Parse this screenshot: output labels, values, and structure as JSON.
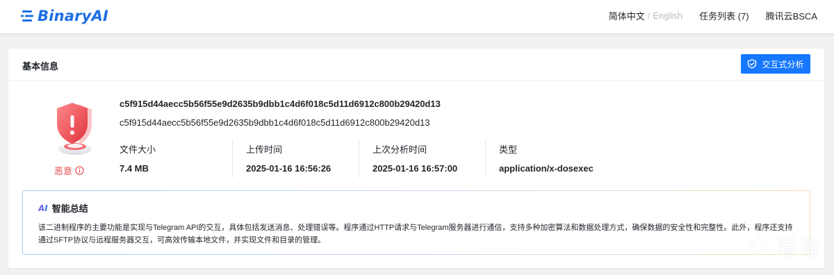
{
  "brand": {
    "name": "BinaryAI",
    "color": "#1b6fe4"
  },
  "nav": {
    "lang_current": "简体中文",
    "lang_separator": "/",
    "lang_other": "English",
    "tasks": "任务列表 (7)",
    "user": "腾讯云BSCA"
  },
  "card": {
    "title": "基本信息",
    "analyze_button": "交互式分析"
  },
  "file": {
    "verdict": "恶意",
    "verdict_color": "#e5484d",
    "hash_primary": "c5f915d44aecc5b56f55e9d2635b9dbb1c4d6f018c5d11d6912c800b29420d13",
    "hash_secondary": "c5f915d44aecc5b56f55e9d2635b9dbb1c4d6f018c5d11d6912c800b29420d13",
    "meta": [
      {
        "label": "文件大小",
        "value": "7.4 MB"
      },
      {
        "label": "上传时间",
        "value": "2025-01-16 16:56:26"
      },
      {
        "label": "上次分析时间",
        "value": "2025-01-16 16:57:00"
      },
      {
        "label": "类型",
        "value": "application/x-dosexec"
      }
    ]
  },
  "ai_summary": {
    "badge": "AI",
    "title": "智能总结",
    "text": "该二进制程序的主要功能是实现与Telegram API的交互，具体包括发送消息、处理错误等。程序通过HTTP请求与Telegram服务器进行通信，支持多种加密算法和数据处理方式，确保数据的安全性和完整性。此外，程序还支持通过SFTP协议与远程服务器交互，可高效传输本地文件，并实现文件和目录的管理。"
  },
  "watermark": {
    "text": "看雪"
  },
  "icons": {
    "logo": "binaryai-logo-icon",
    "analyze": "shield-check-icon",
    "threat": "malicious-shield-icon",
    "info": "info-circle-icon",
    "watermark": "kanxue-snowflake-icon"
  },
  "colors": {
    "accent": "#1677ff",
    "danger": "#e5484d",
    "page_bg": "#f0f1f3"
  }
}
